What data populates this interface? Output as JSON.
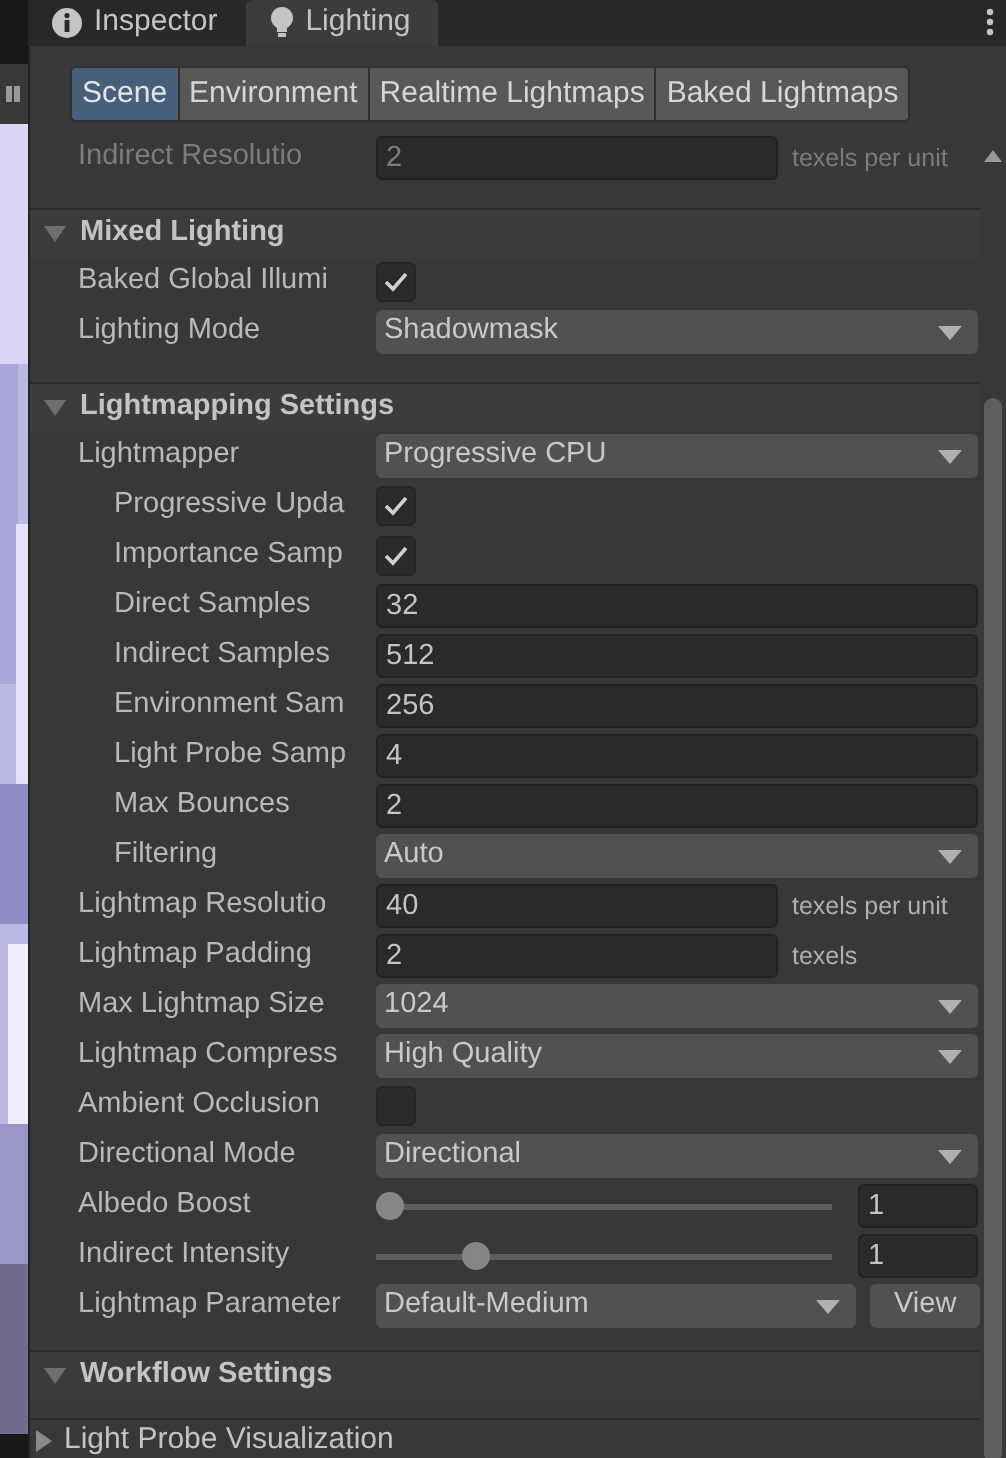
{
  "tabs": [
    {
      "label": "Inspector",
      "selected": false
    },
    {
      "label": "Lighting",
      "selected": true
    }
  ],
  "subtabs": [
    {
      "label": "Scene",
      "selected": true
    },
    {
      "label": "Environment",
      "selected": false
    },
    {
      "label": "Realtime Lightmaps",
      "selected": false
    },
    {
      "label": "Baked Lightmaps",
      "selected": false
    }
  ],
  "sections": [
    {
      "kind": "rows",
      "rows": [
        {
          "kind": "field",
          "label": "Indirect Resolutio",
          "value": "2",
          "unit": "texels per unit",
          "disabled": true
        }
      ]
    },
    {
      "kind": "header",
      "title": "Mixed Lighting",
      "expanded": true,
      "rows": [
        {
          "kind": "check",
          "label": "Baked Global Illumi",
          "checked": true
        },
        {
          "kind": "dropdown",
          "label": "Lighting Mode",
          "value": "Shadowmask"
        }
      ]
    },
    {
      "kind": "header",
      "title": "Lightmapping Settings",
      "expanded": true,
      "rows": [
        {
          "kind": "dropdown",
          "label": "Lightmapper",
          "value": "Progressive CPU",
          "children": [
            {
              "kind": "check",
              "label": "Progressive Upda",
              "checked": true
            },
            {
              "kind": "check",
              "label": "Importance Samp",
              "checked": true
            },
            {
              "kind": "field",
              "label": "Direct Samples",
              "value": "32"
            },
            {
              "kind": "field",
              "label": "Indirect Samples",
              "value": "512"
            },
            {
              "kind": "field",
              "label": "Environment Sam",
              "value": "256"
            },
            {
              "kind": "field",
              "label": "Light Probe Samp",
              "value": "4"
            },
            {
              "kind": "field",
              "label": "Max Bounces",
              "value": "2"
            },
            {
              "kind": "dropdown",
              "label": "Filtering",
              "value": "Auto"
            }
          ]
        },
        {
          "kind": "field",
          "label": "Lightmap Resolutio",
          "value": "40",
          "unit": "texels per unit"
        },
        {
          "kind": "field",
          "label": "Lightmap Padding",
          "value": "2",
          "unit": "texels"
        },
        {
          "kind": "dropdown",
          "label": "Max Lightmap Size",
          "value": "1024"
        },
        {
          "kind": "dropdown",
          "label": "Lightmap Compress",
          "value": "High Quality"
        },
        {
          "kind": "check",
          "label": "Ambient Occlusion",
          "checked": false
        },
        {
          "kind": "dropdown",
          "label": "Directional Mode",
          "value": "Directional"
        },
        {
          "kind": "slider",
          "label": "Albedo Boost",
          "level": 0,
          "value": "1"
        },
        {
          "kind": "slider",
          "label": "Indirect Intensity",
          "level": 0.2,
          "value": "1"
        },
        {
          "kind": "dropdown",
          "label": "Lightmap Parameter",
          "value": "Default-Medium",
          "button": "View"
        }
      ]
    },
    {
      "kind": "header",
      "title": "Workflow Settings",
      "expanded": true
    },
    {
      "kind": "foldout",
      "title": "Light Probe Visualization",
      "expanded": false
    }
  ]
}
